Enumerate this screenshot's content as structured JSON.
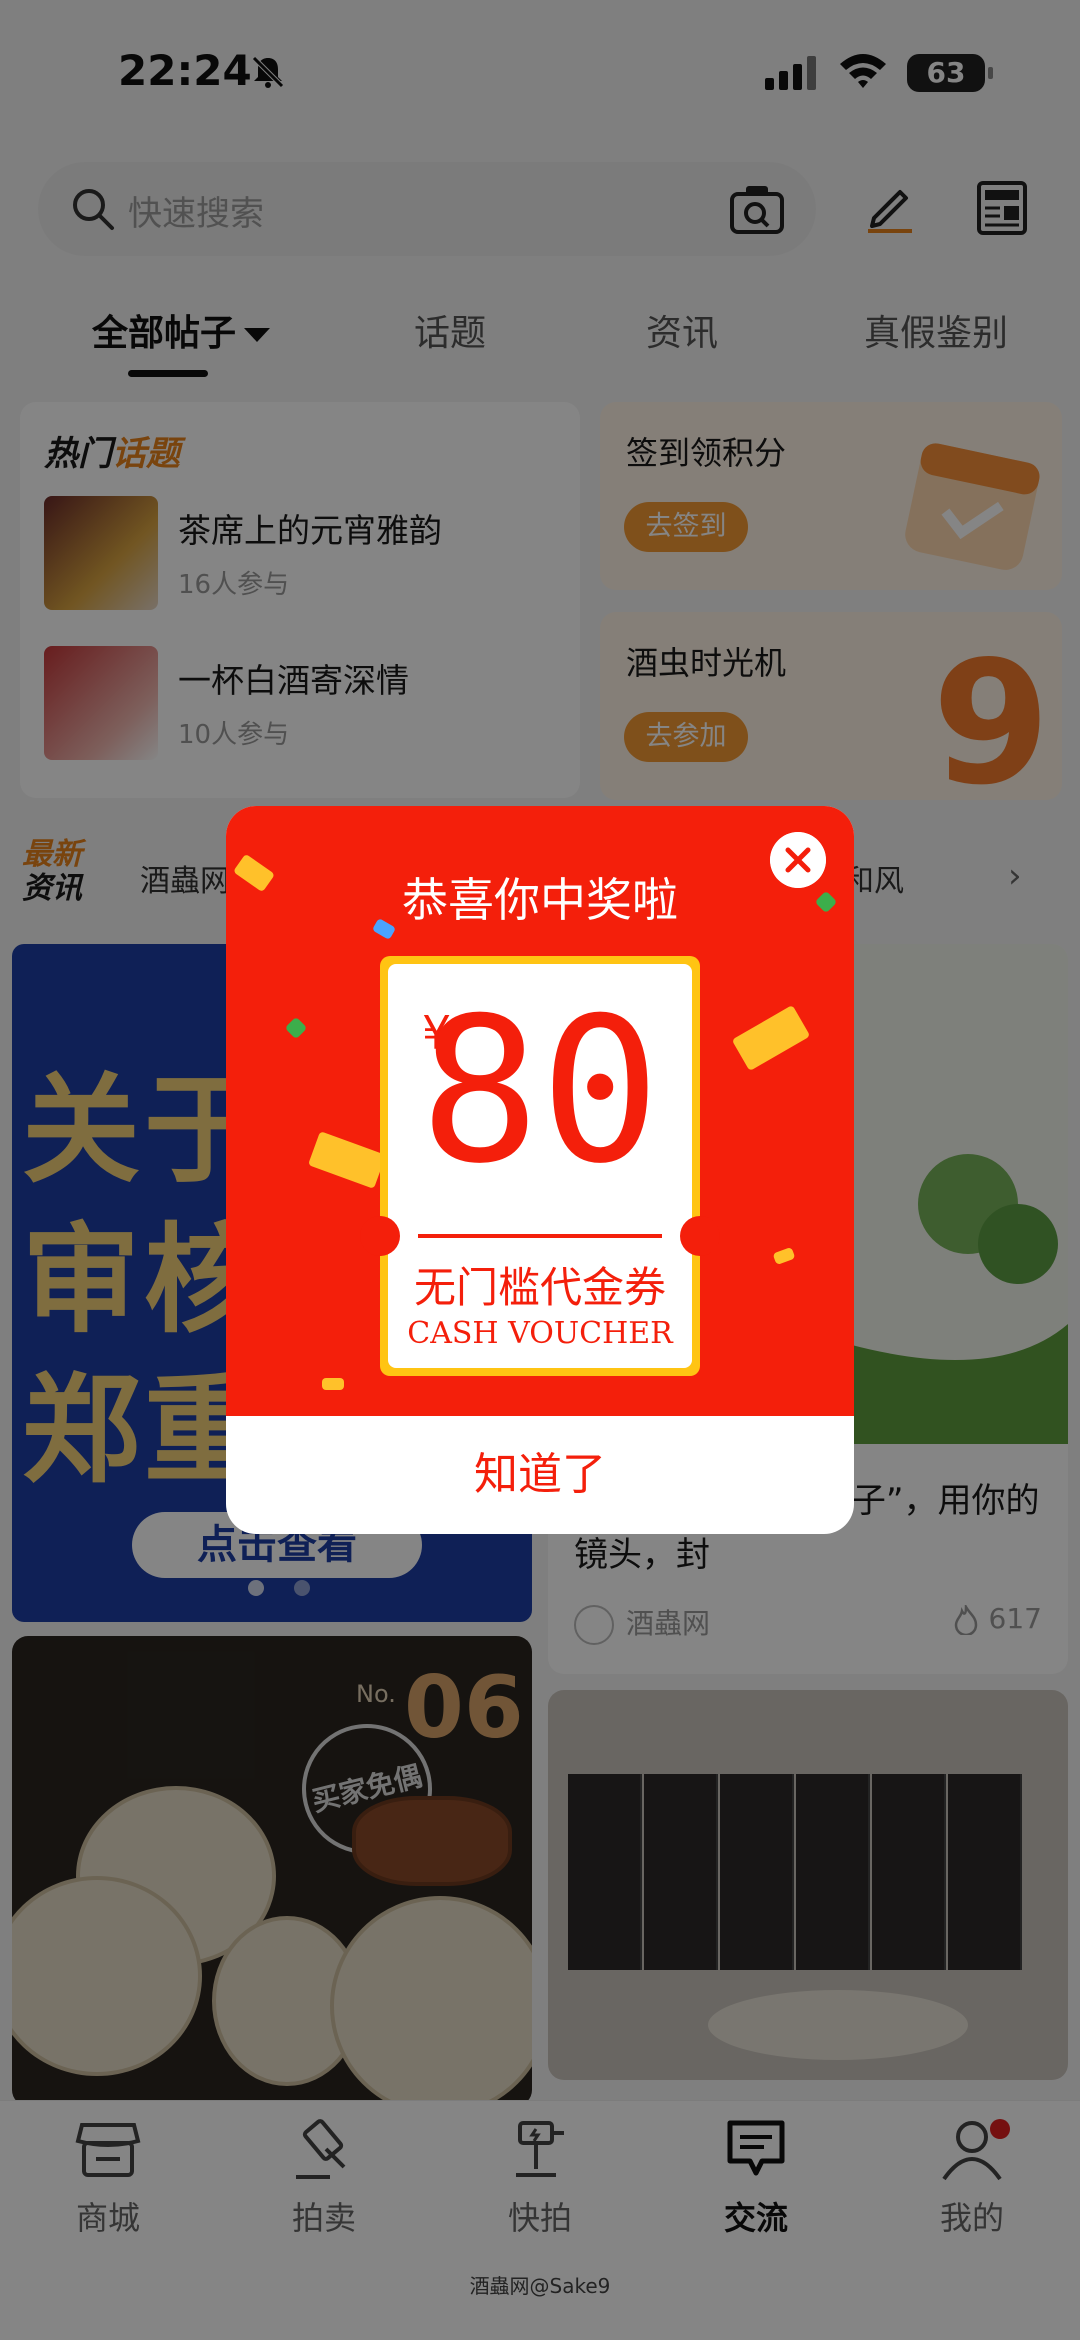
{
  "status": {
    "time": "22:24",
    "battery": "63"
  },
  "search": {
    "placeholder": "快速搜索"
  },
  "tabs": [
    {
      "label": "全部帖子"
    },
    {
      "label": "话题"
    },
    {
      "label": "资讯"
    },
    {
      "label": "真假鉴别"
    }
  ],
  "hot_topics": {
    "title_part1": "热门",
    "title_part2": "话题",
    "items": [
      {
        "title": "茶席上的元宵雅韵",
        "meta": "16人参与"
      },
      {
        "title": "一杯白酒寄深情",
        "meta": "10人参与"
      }
    ]
  },
  "side_cards": [
    {
      "title": "签到领积分",
      "button": "去签到"
    },
    {
      "title": "酒虫时光机",
      "button": "去参加"
    }
  ],
  "news": {
    "label_line1": "最新",
    "label_line2": "资讯",
    "text_left": "酒蟲网",
    "text_right": "和风"
  },
  "feed": {
    "banner": {
      "line1": "关于",
      "line2": "审核",
      "line3": "郑重",
      "button": "点击查看"
    },
    "green_post": {
      "caption": "| 把春天装进“绿瓶子”，用你的镜头，封",
      "author": "酒蟲网",
      "likes": "617"
    },
    "tea_post": {
      "no": "No.",
      "num": "06",
      "stamp": "买家免偶"
    }
  },
  "nav": [
    {
      "label": "商城"
    },
    {
      "label": "拍卖"
    },
    {
      "label": "快拍"
    },
    {
      "label": "交流"
    },
    {
      "label": "我的"
    }
  ],
  "watermark": "酒蟲网@Sake9",
  "modal": {
    "title": "恭喜你中奖啦",
    "currency": "¥",
    "amount": "80",
    "voucher_cn": "无门槛代金券",
    "voucher_en": "CASH VOUCHER",
    "confirm": "知道了"
  }
}
